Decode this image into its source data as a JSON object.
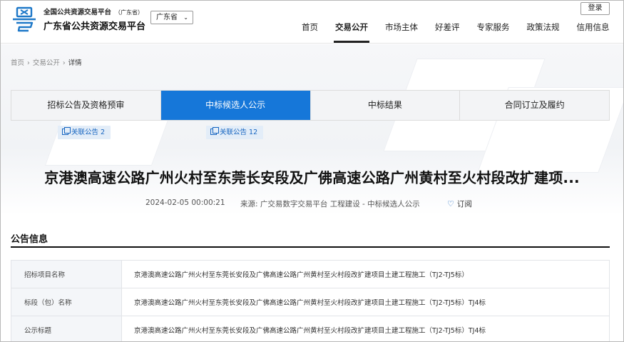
{
  "header": {
    "logo_icon": "yue-character-logo-icon",
    "org_small": "全国公共资源交易平台",
    "org_small_sub": "（广东省）",
    "org_big": "广东省公共资源交易平台",
    "region": "广东省",
    "login": "登录",
    "nav": [
      "首页",
      "交易公开",
      "市场主体",
      "好差评",
      "专家服务",
      "政策法规",
      "信用信息"
    ],
    "nav_active": "交易公开"
  },
  "breadcrumb": [
    "首页",
    "交易公开",
    "详情"
  ],
  "tabs": [
    {
      "label": "招标公告及资格预审",
      "active": false
    },
    {
      "label": "中标候选人公示",
      "active": true
    },
    {
      "label": "中标结果",
      "active": false
    },
    {
      "label": "合同订立及履约",
      "active": false
    }
  ],
  "related": [
    {
      "label": "关联公告 2"
    },
    {
      "label": "关联公告 12"
    }
  ],
  "title": "京港澳高速公路广州火村至东莞长安段及广佛高速公路广州黄村至火村段改扩建项...",
  "meta": {
    "date": "2024-02-05 00:00:21",
    "source": "来源: 广交易数字交易平台 工程建设 - 中标候选人公示",
    "subscribe": "订阅"
  },
  "section": {
    "title": "公告信息",
    "rows": [
      {
        "key": "招标项目名称",
        "value": "京港澳高速公路广州火村至东莞长安段及广佛高速公路广州黄村至火村段改扩建项目土建工程施工（TJ2-TJ5标）"
      },
      {
        "key": "标段（包）名称",
        "value": "京港澳高速公路广州火村至东莞长安段及广佛高速公路广州黄村至火村段改扩建项目土建工程施工（TJ2-TJ5标）TJ4标"
      },
      {
        "key": "公示标题",
        "value": "京港澳高速公路广州火村至东莞长安段及广佛高速公路广州黄村至火村段改扩建项目土建工程施工（TJ2-TJ5标）TJ4标"
      }
    ]
  },
  "colors": {
    "accent": "#1677d9",
    "link": "#1665c0",
    "tab_bg": "#f3f4f6"
  }
}
